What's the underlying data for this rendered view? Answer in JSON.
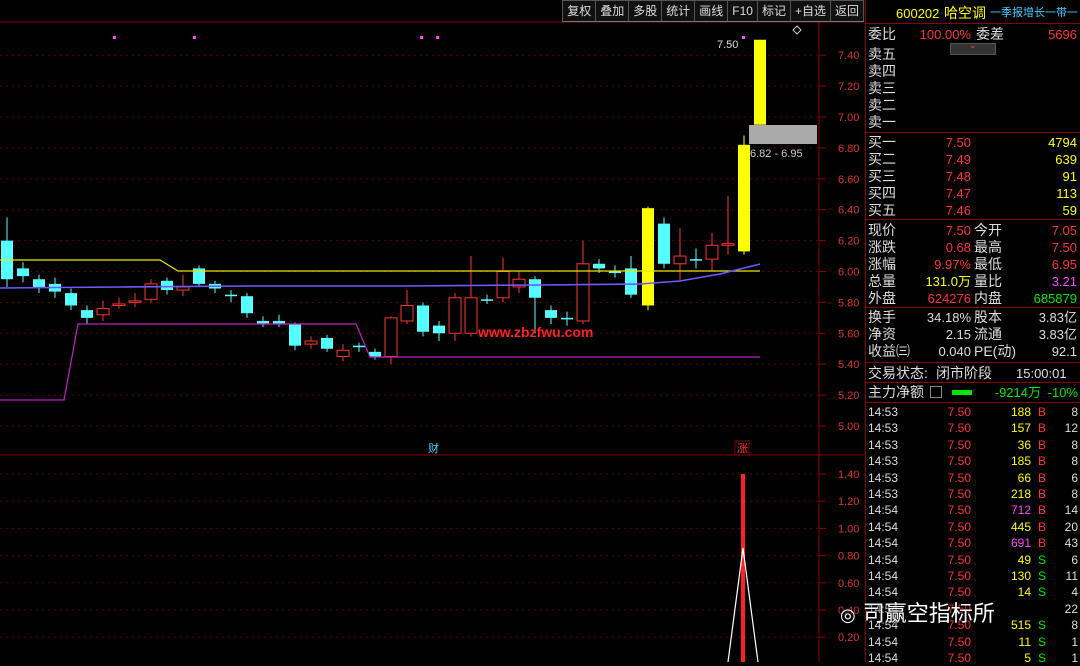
{
  "toolbar": [
    "复权",
    "叠加",
    "多股",
    "统计",
    "画线",
    "F10",
    "标记",
    "+自选",
    "返回"
  ],
  "stock": {
    "code": "600202",
    "name": "哈空调",
    "report": "一季报增长一带一"
  },
  "weibi": {
    "label": "委比",
    "value": "100.00%",
    "diff_label": "委差",
    "diff": "5696"
  },
  "sell_levels": [
    "卖五",
    "卖四",
    "卖三",
    "卖二",
    "卖一"
  ],
  "buy_levels": [
    {
      "label": "买一",
      "price": "7.50",
      "vol": "4794"
    },
    {
      "label": "买二",
      "price": "7.49",
      "vol": "639"
    },
    {
      "label": "买三",
      "price": "7.48",
      "vol": "91"
    },
    {
      "label": "买四",
      "price": "7.47",
      "vol": "113"
    },
    {
      "label": "买五",
      "price": "7.46",
      "vol": "59"
    }
  ],
  "quote": [
    {
      "l1": "现价",
      "v1": "7.50",
      "c1": "red",
      "l2": "今开",
      "v2": "7.05",
      "c2": "red"
    },
    {
      "l1": "涨跌",
      "v1": "0.68",
      "c1": "red",
      "l2": "最高",
      "v2": "7.50",
      "c2": "red"
    },
    {
      "l1": "涨幅",
      "v1": "9.97%",
      "c1": "red",
      "l2": "最低",
      "v2": "6.95",
      "c2": "red"
    },
    {
      "l1": "总量",
      "v1": "131.0万",
      "c1": "yellow",
      "l2": "量比",
      "v2": "3.21",
      "c2": "magenta"
    },
    {
      "l1": "外盘",
      "v1": "624276",
      "c1": "red",
      "l2": "内盘",
      "v2": "685879",
      "c2": "green"
    }
  ],
  "fundamentals": [
    {
      "l1": "换手",
      "v1": "34.18%",
      "l2": "股本",
      "v2": "3.83亿"
    },
    {
      "l1": "净资",
      "v1": "2.15",
      "l2": "流通",
      "v2": "3.83亿"
    },
    {
      "l1": "收益㈢",
      "v1": "0.040",
      "l2": "PE(动)",
      "v2": "92.1"
    }
  ],
  "trade_status": {
    "label": "交易状态:",
    "value": "闭市阶段",
    "time": "15:00:01"
  },
  "main_flow": {
    "label": "主力净额",
    "value": "-9214万",
    "pct": "-10%"
  },
  "ticks": [
    {
      "t": "14:53",
      "p": "7.50",
      "v": "188",
      "bs": "B",
      "n": "8",
      "vc": "yellow"
    },
    {
      "t": "14:53",
      "p": "7.50",
      "v": "157",
      "bs": "B",
      "n": "12",
      "vc": "yellow"
    },
    {
      "t": "14:53",
      "p": "7.50",
      "v": "36",
      "bs": "B",
      "n": "8",
      "vc": "yellow"
    },
    {
      "t": "14:53",
      "p": "7.50",
      "v": "185",
      "bs": "B",
      "n": "8",
      "vc": "yellow"
    },
    {
      "t": "14:53",
      "p": "7.50",
      "v": "66",
      "bs": "B",
      "n": "6",
      "vc": "yellow"
    },
    {
      "t": "14:53",
      "p": "7.50",
      "v": "218",
      "bs": "B",
      "n": "8",
      "vc": "yellow"
    },
    {
      "t": "14:54",
      "p": "7.50",
      "v": "712",
      "bs": "B",
      "n": "14",
      "vc": "magenta"
    },
    {
      "t": "14:54",
      "p": "7.50",
      "v": "445",
      "bs": "B",
      "n": "20",
      "vc": "yellow"
    },
    {
      "t": "14:54",
      "p": "7.50",
      "v": "691",
      "bs": "B",
      "n": "43",
      "vc": "magenta"
    },
    {
      "t": "14:54",
      "p": "7.50",
      "v": "49",
      "bs": "S",
      "n": "6",
      "vc": "yellow"
    },
    {
      "t": "14:54",
      "p": "7.50",
      "v": "130",
      "bs": "S",
      "n": "11",
      "vc": "yellow"
    },
    {
      "t": "14:54",
      "p": "7.50",
      "v": "14",
      "bs": "S",
      "n": "4",
      "vc": "yellow"
    },
    {
      "t": "14:54",
      "p": "7.50",
      "v": "",
      "bs": "",
      "n": "22",
      "vc": "yellow"
    },
    {
      "t": "14:54",
      "p": "7.50",
      "v": "515",
      "bs": "S",
      "n": "8",
      "vc": "yellow"
    },
    {
      "t": "14:54",
      "p": "7.50",
      "v": "11",
      "bs": "S",
      "n": "1",
      "vc": "yellow"
    },
    {
      "t": "14:54",
      "p": "7.50",
      "v": "5",
      "bs": "S",
      "n": "1",
      "vc": "yellow"
    }
  ],
  "price_axis": [
    "7.40",
    "7.20",
    "7.00",
    "6.80",
    "6.60",
    "6.40",
    "6.20",
    "6.00",
    "5.80",
    "5.60",
    "5.40",
    "5.20",
    "5.00"
  ],
  "sub_axis": [
    "1.40",
    "1.20",
    "1.00",
    "0.80",
    "0.60",
    "0.40",
    "0.20"
  ],
  "labels": {
    "high_marker": "7.50",
    "band": "6.82 - 6.95",
    "url": "www.zbzfwu.com",
    "cai": "财",
    "zhang": "涨"
  },
  "watermark": "司赢空指标所"
}
